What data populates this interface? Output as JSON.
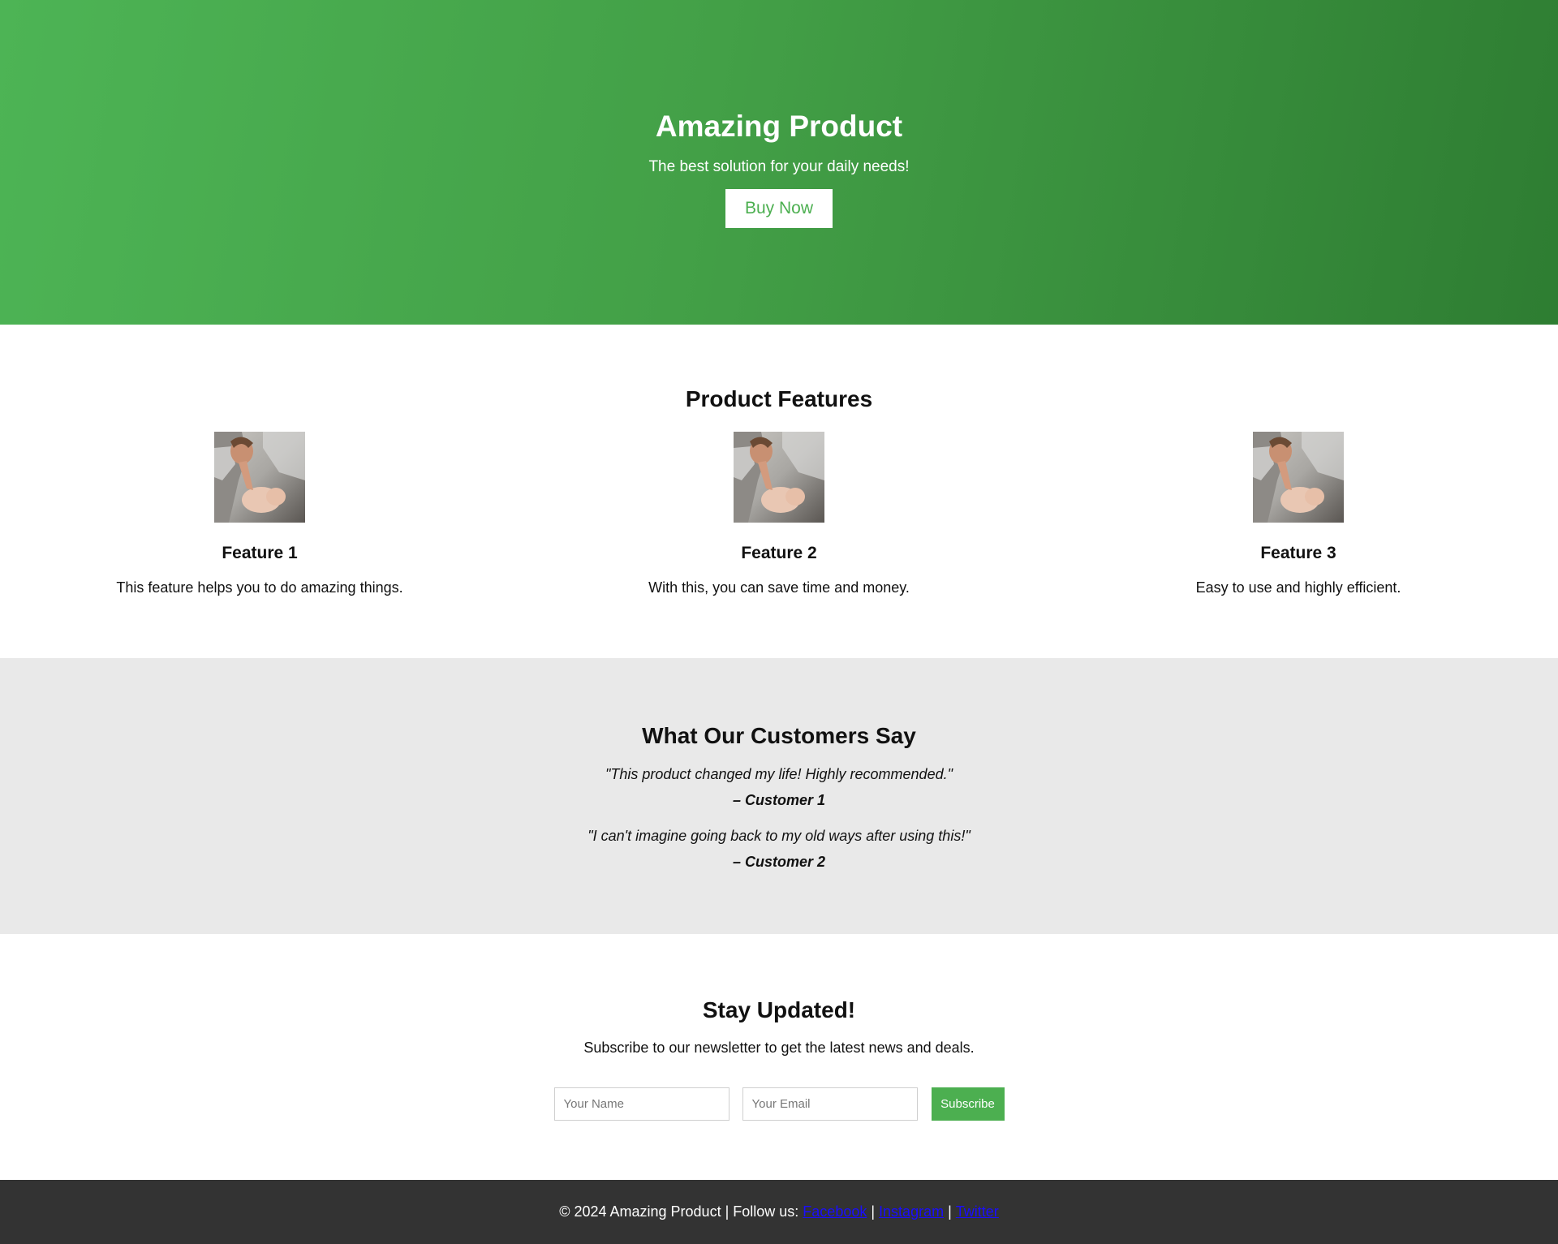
{
  "colors": {
    "accent": "#4CAF50",
    "hero_dark": "#2e7d32",
    "testimonial_bg": "#e9e9e9",
    "footer_bg": "#333333",
    "link": "#1a0dff"
  },
  "hero": {
    "title": "Amazing Product",
    "subtitle": "The best solution for your daily needs!",
    "button_label": "Buy Now"
  },
  "features": {
    "heading": "Product Features",
    "items": [
      {
        "title": "Feature 1",
        "description": "This feature helps you to do amazing things.",
        "image": "mother-and-baby-photo"
      },
      {
        "title": "Feature 2",
        "description": "With this, you can save time and money.",
        "image": "mother-and-baby-photo"
      },
      {
        "title": "Feature 3",
        "description": "Easy to use and highly efficient.",
        "image": "mother-and-baby-photo"
      }
    ]
  },
  "testimonials": {
    "heading": "What Our Customers Say",
    "items": [
      {
        "quote": "\"This product changed my life! Highly recommended.\"",
        "author": "– Customer 1"
      },
      {
        "quote": "\"I can't imagine going back to my old ways after using this!\"",
        "author": "– Customer 2"
      }
    ]
  },
  "newsletter": {
    "heading": "Stay Updated!",
    "text": "Subscribe to our newsletter to get the latest news and deals.",
    "name_placeholder": "Your Name",
    "email_placeholder": "Your Email",
    "button_label": "Subscribe"
  },
  "footer": {
    "text": "© 2024 Amazing Product | Follow us:",
    "links": [
      "Facebook",
      "Instagram",
      "Twitter"
    ],
    "separator": "|"
  }
}
